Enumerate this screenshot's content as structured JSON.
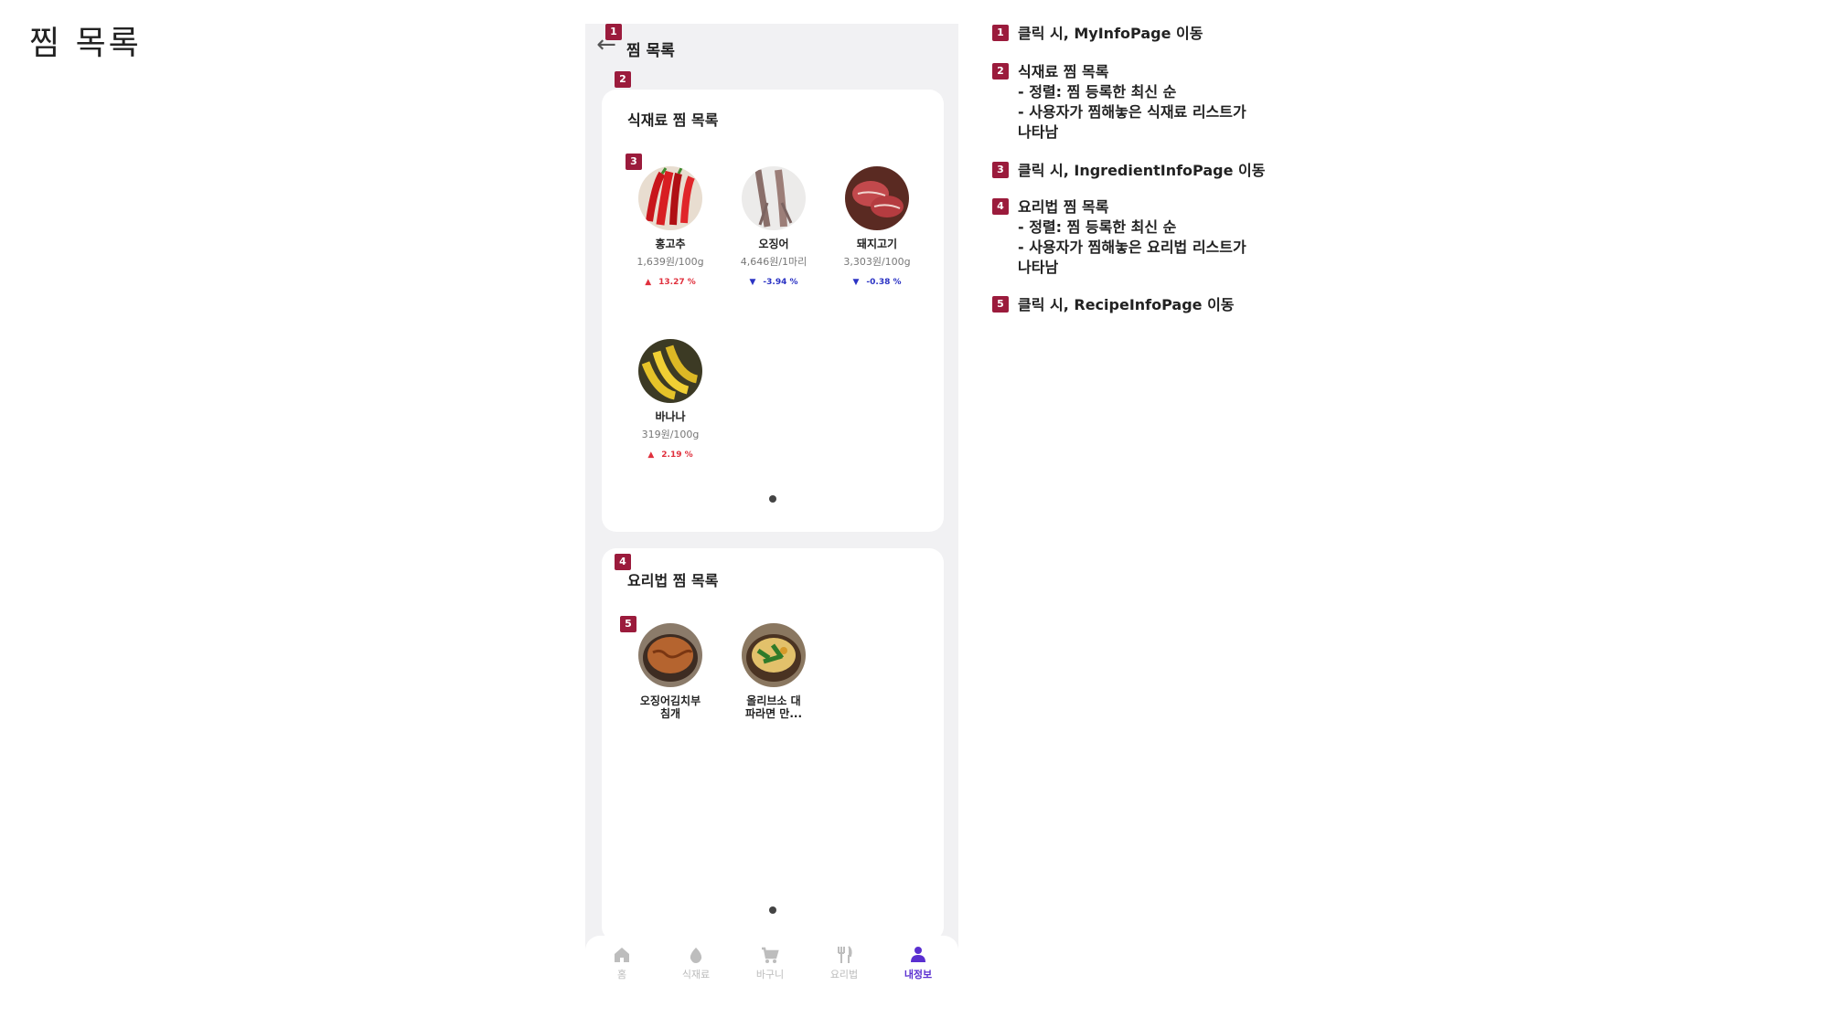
{
  "slide_title": "찜 목록",
  "phone": {
    "topbar": {
      "back_icon": "arrow-left-icon",
      "title": "찜 목록"
    },
    "ingredient_section": {
      "title": "식재료 찜 목록",
      "items": [
        {
          "name": "홍고추",
          "price": "1,639원/100g",
          "change": "13.27 %",
          "direction": "up"
        },
        {
          "name": "오징어",
          "price": "4,646원/1마리",
          "change": "-3.94 %",
          "direction": "down"
        },
        {
          "name": "돼지고기",
          "price": "3,303원/100g",
          "change": "-0.38 %",
          "direction": "down"
        },
        {
          "name": "바나나",
          "price": "319원/100g",
          "change": "2.19 %",
          "direction": "up"
        }
      ]
    },
    "recipe_section": {
      "title": "요리법 찜 목록",
      "items": [
        {
          "name_line1": "오징어김치부",
          "name_line2": "침개"
        },
        {
          "name_line1": "올리브소 대",
          "name_line2": "파라면 만..."
        }
      ]
    },
    "tabbar": [
      {
        "label": "홈",
        "icon": "home-icon",
        "active": false
      },
      {
        "label": "식재료",
        "icon": "ingredient-icon",
        "active": false
      },
      {
        "label": "바구니",
        "icon": "cart-icon",
        "active": false
      },
      {
        "label": "요리법",
        "icon": "fork-knife-icon",
        "active": false
      },
      {
        "label": "내정보",
        "icon": "person-icon",
        "active": true
      }
    ]
  },
  "badges": [
    "1",
    "2",
    "3",
    "4",
    "5"
  ],
  "notes": [
    {
      "badge": "1",
      "lines": [
        "클릭 시, MyInfoPage 이동"
      ]
    },
    {
      "badge": "2",
      "lines": [
        "식재료 찜 목록",
        "- 정렬: 찜 등록한 최신 순",
        "- 사용자가 찜해놓은 식재료 리스트가",
        "나타남"
      ]
    },
    {
      "badge": "3",
      "lines": [
        "클릭 시, IngredientInfoPage 이동"
      ]
    },
    {
      "badge": "4",
      "lines": [
        "요리법 찜 목록",
        "- 정렬: 찜 등록한 최신 순",
        "- 사용자가 찜해놓은 요리법 리스트가",
        "나타남"
      ]
    },
    {
      "badge": "5",
      "lines": [
        "클릭 시, RecipeInfoPage 이동"
      ]
    }
  ],
  "colors": {
    "badge": "#9b1b3c",
    "up": "#e0303d",
    "down": "#2b33c4",
    "active_tab": "#5a2fd0",
    "phone_bg": "#f1f1f3"
  }
}
